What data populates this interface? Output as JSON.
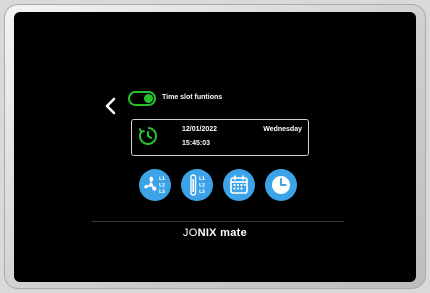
{
  "device": {
    "colors": {
      "accent_green": "#26c22e",
      "icon_blue": "#3ca3e8",
      "screen_bg": "#000000"
    }
  },
  "header": {
    "back_icon": "chevron-left-icon",
    "toggle_state": "on",
    "toggle_label": "Time slot funtions"
  },
  "status_panel": {
    "icon": "clock-icon",
    "date": "12/01/2022",
    "time": "15:45:03",
    "day": "Wednesday"
  },
  "function_buttons": [
    {
      "icon": "fan-speed-icon",
      "labels": [
        "L1",
        "L2",
        "L3"
      ]
    },
    {
      "icon": "levels-icon",
      "labels": [
        "L1",
        "L2",
        "L3"
      ]
    },
    {
      "icon": "calendar-icon"
    },
    {
      "icon": "clock-icon"
    }
  ],
  "brand": {
    "part1": "JO",
    "part2": "NIX",
    "part3": " mate"
  }
}
